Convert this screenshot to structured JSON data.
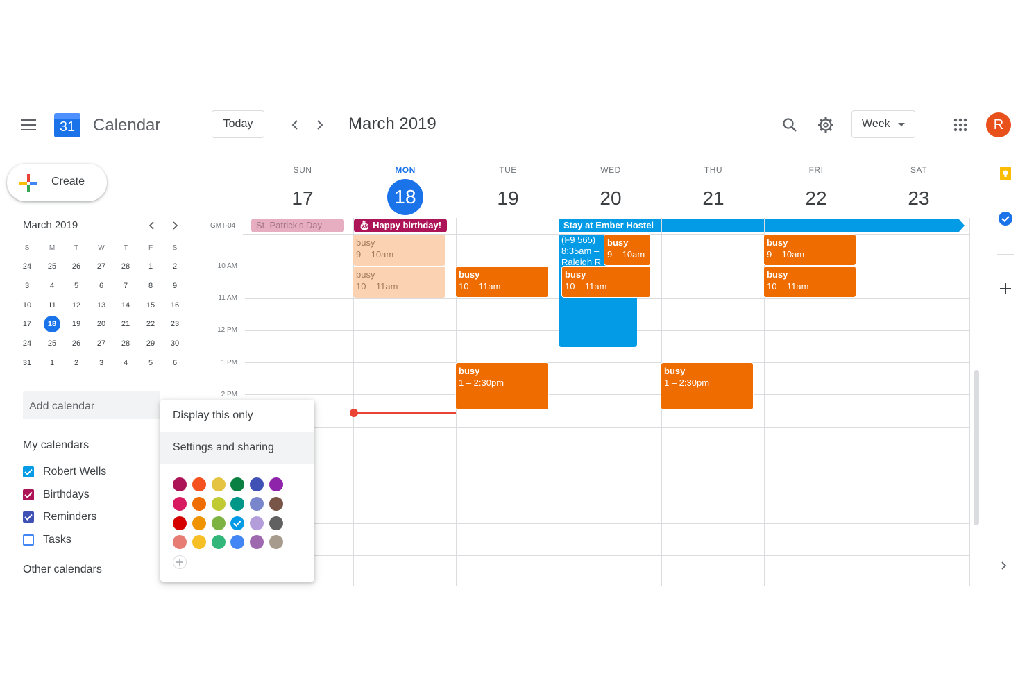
{
  "app": {
    "title": "Calendar",
    "logo_day": "31"
  },
  "header": {
    "today_label": "Today",
    "current_period": "March 2019",
    "view_label": "Week",
    "avatar_initial": "R"
  },
  "sidebar": {
    "create_label": "Create",
    "mini_month": "March 2019",
    "weekday_heads": [
      "S",
      "M",
      "T",
      "W",
      "T",
      "F",
      "S"
    ],
    "weeks": [
      [
        "24",
        "25",
        "26",
        "27",
        "28",
        "1",
        "2"
      ],
      [
        "3",
        "4",
        "5",
        "6",
        "7",
        "8",
        "9"
      ],
      [
        "10",
        "11",
        "12",
        "13",
        "14",
        "15",
        "16"
      ],
      [
        "17",
        "18",
        "19",
        "20",
        "21",
        "22",
        "23"
      ],
      [
        "24",
        "25",
        "26",
        "27",
        "28",
        "29",
        "30"
      ],
      [
        "31",
        "1",
        "2",
        "3",
        "4",
        "5",
        "6"
      ]
    ],
    "today": "18",
    "add_calendar_placeholder": "Add calendar",
    "my_calendars_title": "My calendars",
    "my_calendars": [
      {
        "name": "Robert Wells",
        "color": "#039be5",
        "checked": true
      },
      {
        "name": "Birthdays",
        "color": "#ad1457",
        "checked": true
      },
      {
        "name": "Reminders",
        "color": "#3f51b5",
        "checked": true
      },
      {
        "name": "Tasks",
        "color": "#4285f4",
        "checked": false
      }
    ],
    "other_calendars_title": "Other calendars"
  },
  "week": {
    "timezone": "GMT-04",
    "days": [
      {
        "dow": "SUN",
        "num": "17",
        "today": false
      },
      {
        "dow": "MON",
        "num": "18",
        "today": true
      },
      {
        "dow": "TUE",
        "num": "19",
        "today": false
      },
      {
        "dow": "WED",
        "num": "20",
        "today": false
      },
      {
        "dow": "THU",
        "num": "21",
        "today": false
      },
      {
        "dow": "FRI",
        "num": "22",
        "today": false
      },
      {
        "dow": "SAT",
        "num": "23",
        "today": false
      }
    ],
    "time_labels": [
      "10 AM",
      "11 AM",
      "12 PM",
      "1 PM",
      "2 PM"
    ],
    "all_day": {
      "st_patricks": "St. Patrick's Day",
      "birthday": "Happy birthday!",
      "hostel": "Stay at Ember Hostel"
    },
    "events": {
      "mon_1_title": "busy",
      "mon_1_time": "9 – 10am",
      "mon_2_title": "busy",
      "mon_2_time": "10 – 11am",
      "tue_1_title": "busy",
      "tue_1_time": "10 – 11am",
      "tue_2_title": "busy",
      "tue_2_time": "1 – 2:30pm",
      "wed_flight_1": "(F9 565)",
      "wed_flight_2": "8:35am –",
      "wed_flight_3": "Raleigh R",
      "wed_1_title": "busy",
      "wed_1_time": "9 – 10am",
      "wed_2_title": "busy",
      "wed_2_time": "10 – 11am",
      "thu_1_title": "busy",
      "thu_1_time": "1 – 2:30pm",
      "fri_1_title": "busy",
      "fri_1_time": "9 – 10am",
      "fri_2_title": "busy",
      "fri_2_time": "10 – 11am"
    }
  },
  "popup": {
    "display_only": "Display this only",
    "settings": "Settings and sharing",
    "colors": [
      [
        "#ad1457",
        "#f4511e",
        "#e4c441",
        "#0b8043",
        "#3f51b5",
        "#8e24aa"
      ],
      [
        "#d81b60",
        "#ef6c00",
        "#c0ca33",
        "#009688",
        "#7986cb",
        "#795548"
      ],
      [
        "#d50000",
        "#f09300",
        "#7cb342",
        "#039be5",
        "#b39ddb",
        "#616161"
      ],
      [
        "#e67c73",
        "#f6bf26",
        "#33b679",
        "#4285f4",
        "#9e69af",
        "#a79b8e"
      ]
    ],
    "selected_color": "#039be5"
  },
  "colors": {
    "accent": "#1a73e8",
    "event_orange": "#ef6c00",
    "now_line": "#ea4335"
  }
}
